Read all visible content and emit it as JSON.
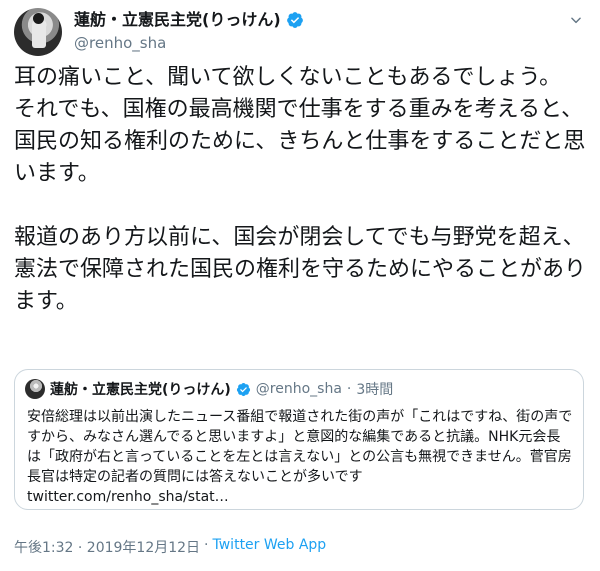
{
  "header": {
    "display_name": "蓮舫・立憲民主党(りっけん)",
    "handle": "@renho_sha",
    "verified_icon": "verified-badge-icon",
    "menu_icon": "chevron-down-icon"
  },
  "tweet": {
    "paragraph1": "耳の痛いこと、聞いて欲しくないこともあるでしょう。\nそれでも、国権の最高機関で仕事をする重みを考えると、国民の知る権利のために、きちんと仕事をすることだと思います。",
    "paragraph2": "報道のあり方以前に、国会が閉会してでも与野党を超え、憲法で保障された国民の権利を守るためにやることがあります。"
  },
  "quote": {
    "display_name": "蓮舫・立憲民主党(りっけん)",
    "handle": "@renho_sha",
    "separator": "·",
    "time": "3時間",
    "text": "安倍総理は以前出演したニュース番組で報道された街の声が「これはですね、街の声ですから、みなさん選んでると思いますよ」と意図的な編集であると抗議。NHK元会長は「政府が右と言っていることを左とは言えない」との公言も無視できません。菅官房長官は特定の記者の質問には答えないことが多いです",
    "link": "twitter.com/renho_sha/stat…"
  },
  "footer": {
    "timestamp": "午後1:32 · 2019年12月12日",
    "separator": "·",
    "source": "Twitter Web App"
  },
  "colors": {
    "text": "#14171a",
    "secondary": "#657786",
    "accent": "#1da1f2",
    "border": "#ccd6dd"
  }
}
